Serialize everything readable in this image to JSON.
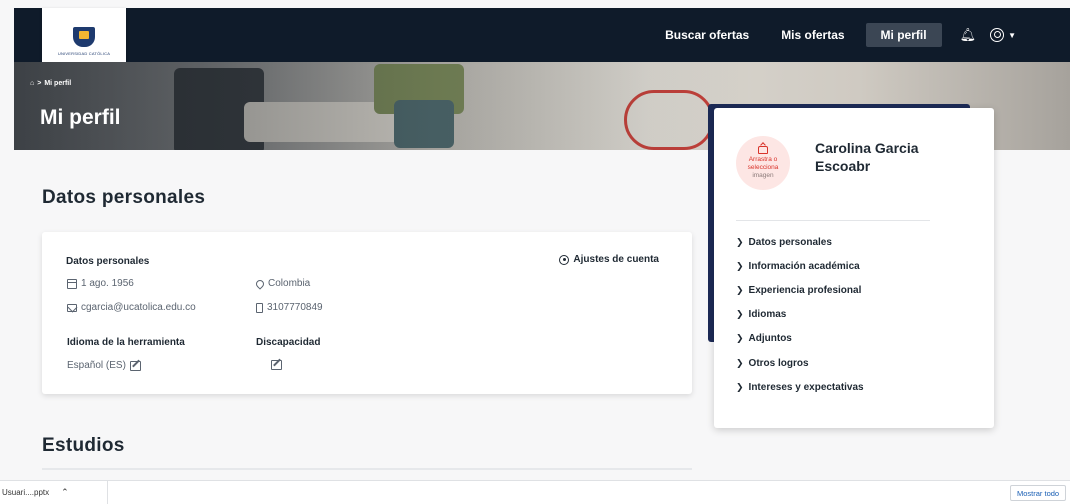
{
  "nav": {
    "logo_text": "UNIVERSIDAD CATÓLICA",
    "links": [
      "Buscar ofertas",
      "Mis ofertas",
      "Mi perfil"
    ],
    "active_link": "Mi perfil",
    "bell_icon": "bell-icon",
    "user_icon": "user-circle-icon"
  },
  "hero": {
    "breadcrumb_home_icon": "home-icon",
    "breadcrumb_separator": ">",
    "breadcrumb_current": "Mi perfil",
    "title": "Mi perfil"
  },
  "personal": {
    "section_title": "Datos personales",
    "card_heading": "Datos personales",
    "settings_label": "Ajustes de cuenta",
    "birth_date": "1 ago. 1956",
    "country": "Colombia",
    "email": "cgarcia@ucatolica.edu.co",
    "phone": "3107770849",
    "tool_language_label": "Idioma de la herramienta",
    "tool_language_value": "Español (ES)",
    "disability_label": "Discapacidad"
  },
  "studies": {
    "section_title": "Estudios"
  },
  "profile_panel": {
    "avatar_line1": "Arrastra o",
    "avatar_line2": "selecciona",
    "avatar_line3": "imagen",
    "name": "Carolina Garcia Escoabr",
    "menu": [
      "Datos personales",
      "Información académica",
      "Experiencia profesional",
      "Idiomas",
      "Adjuntos",
      "Otros logros",
      "Intereses y expectativas"
    ]
  },
  "download_bar": {
    "file_label": "Usuari....pptx",
    "show_all_label": "Mostrar todo"
  },
  "colors": {
    "nav_bg": "#0f1b2a",
    "panel_accent": "#1c2a56",
    "avatar_accent": "#d9342b"
  }
}
